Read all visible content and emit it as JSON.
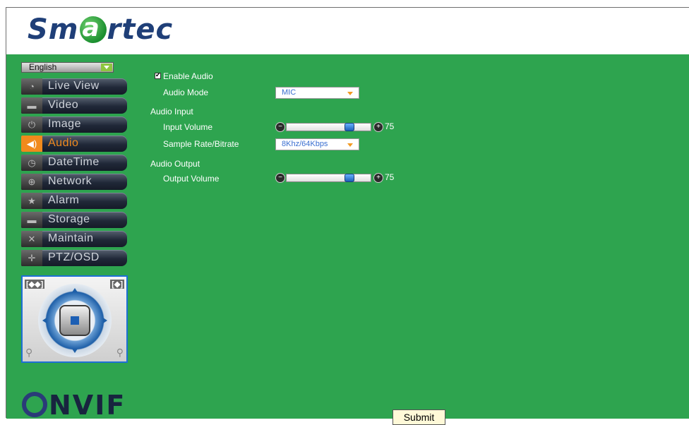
{
  "header": {
    "logo_text": "Smartec"
  },
  "sidebar": {
    "language": "English",
    "items": [
      {
        "label": "Live View",
        "icon": "chat-icon"
      },
      {
        "label": "Video",
        "icon": "camera-icon"
      },
      {
        "label": "Image",
        "icon": "power-icon"
      },
      {
        "label": "Audio",
        "icon": "speaker-icon",
        "active": true
      },
      {
        "label": "DateTime",
        "icon": "clock-icon"
      },
      {
        "label": "Network",
        "icon": "globe-icon"
      },
      {
        "label": "Alarm",
        "icon": "star-icon"
      },
      {
        "label": "Storage",
        "icon": "folder-icon"
      },
      {
        "label": "Maintain",
        "icon": "tools-icon"
      },
      {
        "label": "PTZ/OSD",
        "icon": "move-icon"
      }
    ],
    "ptz": {
      "left_label": "[◆◆]",
      "right_label": "[◆]"
    },
    "brand_text": "NVIF"
  },
  "form": {
    "enable_audio_label": "Enable Audio",
    "enable_audio_checked": true,
    "audio_mode_label": "Audio Mode",
    "audio_mode_value": "MIC",
    "audio_input_label": "Audio Input",
    "input_volume_label": "Input Volume",
    "input_volume_value": "75",
    "sample_rate_label": "Sample Rate/Bitrate",
    "sample_rate_value": "8Khz/64Kbps",
    "audio_output_label": "Audio Output",
    "output_volume_label": "Output Volume",
    "output_volume_value": "75",
    "submit_label": "Submit"
  },
  "colors": {
    "background": "#2ea44f",
    "accent": "#f18a1c",
    "link": "#3a6fd0"
  }
}
